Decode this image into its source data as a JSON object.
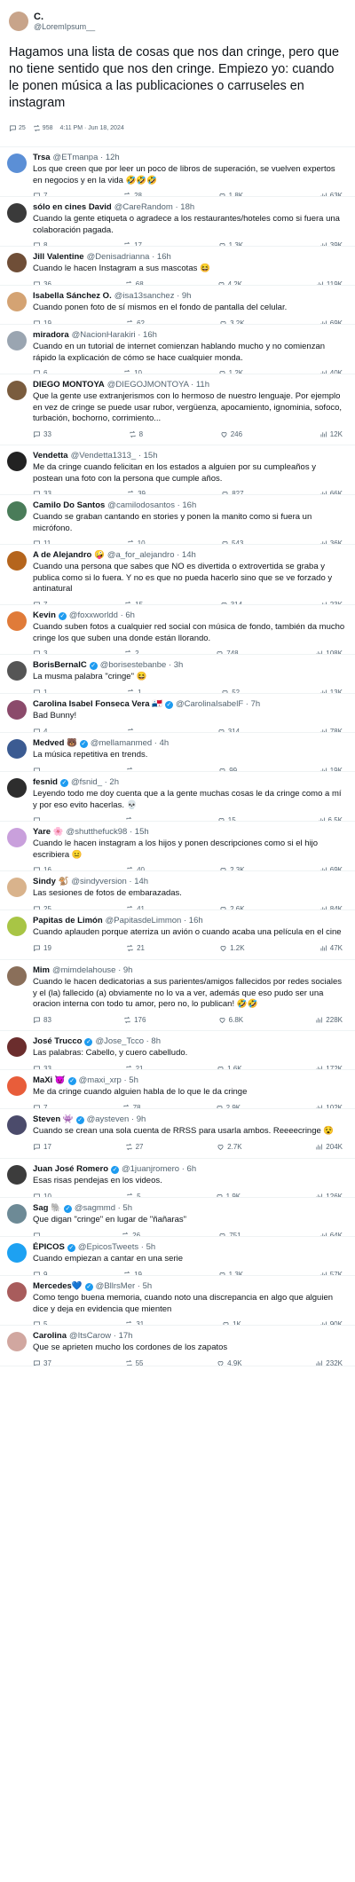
{
  "op": {
    "name": "C.",
    "handle": "@LoremIpsum__",
    "text": "Hagamos una lista de cosas que nos dan cringe, pero que no tiene sentido que nos den cringe. Empiezo yo: cuando le ponen música a las publicaciones o carruseles en instagram",
    "replies": "25",
    "reposts": "958",
    "timestamp": "4:11 PM · Jun 18, 2024",
    "avatar_color": "#c8a48a"
  },
  "replies": [
    {
      "name": "Trsa",
      "handle": "@ETmanpa · 12h",
      "verified": false,
      "text": "Los que creen que por leer un poco de libros de superación, se vuelven expertos en negocios y en la vida 🤣🤣🤣",
      "replies": "7",
      "reposts": "28",
      "likes": "1.8K",
      "views": "63K",
      "avatar": "#5b8fd6",
      "h": 56
    },
    {
      "name": "sólo en cines David",
      "handle": "@CareRandom · 18h",
      "verified": false,
      "text": "Cuando la gente etiqueta o agradece a los restaurantes/hoteles como si fuera una colaboración pagada.",
      "replies": "8",
      "reposts": "17",
      "likes": "1.3K",
      "views": "39K",
      "avatar": "#3a3a3a",
      "h": 56
    },
    {
      "name": "Jill Valentine",
      "handle": "@Denisadrianna · 16h",
      "verified": false,
      "text": "Cuando le hacen Instagram a sus mascotas 😆",
      "replies": "36",
      "reposts": "68",
      "likes": "4.2K",
      "views": "119K",
      "avatar": "#6f4e37",
      "h": 44
    },
    {
      "name": "Isabella Sánchez O.",
      "handle": "@isa13sanchez · 9h",
      "verified": false,
      "text": "Cuando ponen foto de sí mismos en el fondo de pantalla del celular.",
      "replies": "19",
      "reposts": "62",
      "likes": "3.2K",
      "views": "69K",
      "avatar": "#d4a373",
      "h": 44
    },
    {
      "name": "miradora",
      "handle": "@NacionHarakiri · 16h",
      "verified": false,
      "text": "Cuando en un tutorial de internet comienzan hablando mucho y no comienzan rápido la explicación de cómo se hace cualquier monda.",
      "replies": "6",
      "reposts": "10",
      "likes": "1.2K",
      "views": "40K",
      "avatar": "#9aa5b1",
      "h": 56
    },
    {
      "name": "DIEGO MONTOYA",
      "handle": "@DIEGOJMONTOYA · 11h",
      "verified": false,
      "text": "Que la gente use extranjerismos con lo hermoso de nuestro lenguaje. Por ejemplo en vez de cringe se puede usar rubor, vergüenza, apocamiento, ignominia, sofoco, turbación, bochorno, corrimiento...",
      "replies": "33",
      "reposts": "8",
      "likes": "246",
      "views": "12K",
      "avatar": "#7a5c3e",
      "h": 80
    },
    {
      "name": "Vendetta",
      "handle": "@Vendetta1313_ · 15h",
      "verified": false,
      "text": "Me da cringe cuando felicitan en los estados a alguien por su cumpleaños y postean una foto con la persona que cumple años.",
      "replies": "33",
      "reposts": "39",
      "likes": "827",
      "views": "66K",
      "avatar": "#222",
      "h": 56
    },
    {
      "name": "Camilo Do Santos",
      "handle": "@camilodosantos · 16h",
      "verified": false,
      "text": "Cuando se graban cantando en stories y ponen la manito como si fuera un micrófono.",
      "replies": "11",
      "reposts": "10",
      "likes": "543",
      "views": "36K",
      "avatar": "#4a7c59",
      "h": 56
    },
    {
      "name": "A de Alejandro 🤪",
      "handle": "@a_for_alejandro · 14h",
      "verified": false,
      "text": "Cuando una persona que sabes que NO es divertida o extrovertida se graba y publica como si lo fuera. Y no es que no pueda hacerlo sino que se ve forzado y antinatural",
      "replies": "7",
      "reposts": "15",
      "likes": "314",
      "views": "23K",
      "avatar": "#b5651d",
      "h": 68
    },
    {
      "name": "Kevin",
      "handle": "@foxxworldd · 6h",
      "verified": true,
      "text": "Cuando suben fotos a cualquier red social con música de fondo, también da mucho cringe los que suben una donde están llorando.",
      "replies": "3",
      "reposts": "2",
      "likes": "748",
      "views": "108K",
      "avatar": "#e07b39",
      "h": 56
    },
    {
      "name": "BorisBernalC",
      "handle": "@borisestebanbe · 3h",
      "verified": true,
      "text": "La musma palabra \"cringe\" 😆",
      "replies": "1",
      "reposts": "1",
      "likes": "52",
      "views": "13K",
      "avatar": "#555",
      "h": 44
    },
    {
      "name": "Carolina Isabel Fonseca Vera 🇵🇦",
      "handle": "@CarolinaIsabelF · 7h",
      "verified": true,
      "text": "Bad Bunny!",
      "replies": "4",
      "reposts": "",
      "likes": "314",
      "views": "78K",
      "avatar": "#8b4a6b",
      "h": 44
    },
    {
      "name": "Medved 🐻",
      "handle": "@mellamanmed · 4h",
      "verified": true,
      "text": "La música repetitiva en trends.",
      "replies": "",
      "reposts": "",
      "likes": "99",
      "views": "19K",
      "avatar": "#3b5b92",
      "h": 44
    },
    {
      "name": "fesnid",
      "handle": "@fsnid_ · 2h",
      "verified": true,
      "text": "Leyendo todo me doy cuenta que a la gente muchas cosas le da cringe como a mí y por eso evito hacerlas. 💀",
      "replies": "",
      "reposts": "",
      "likes": "15",
      "views": "6.5K",
      "avatar": "#2d2d2d",
      "h": 56
    },
    {
      "name": "Yare 🌸",
      "handle": "@shutthefuck98 · 15h",
      "verified": false,
      "text": "Cuando le hacen instagram a los hijos y ponen descripciones como si el hijo escribiera 😐",
      "replies": "16",
      "reposts": "40",
      "likes": "2.3K",
      "views": "69K",
      "avatar": "#c9a0dc",
      "h": 56
    },
    {
      "name": "Sindy 🐒",
      "handle": "@sindyversion · 14h",
      "verified": false,
      "text": "Las sesiones de fotos de embarazadas.",
      "replies": "25",
      "reposts": "41",
      "likes": "2.6K",
      "views": "84K",
      "avatar": "#d9b38c",
      "h": 44
    },
    {
      "name": "Papitas de Limón",
      "handle": "@PapitasdeLimmon · 16h",
      "verified": false,
      "text": "Cuando aplauden porque aterriza un avión o cuando acaba una película en el cine",
      "replies": "19",
      "reposts": "21",
      "likes": "1.2K",
      "views": "47K",
      "avatar": "#a8c545",
      "h": 56
    },
    {
      "name": "Mim",
      "handle": "@mimdelahouse · 9h",
      "verified": false,
      "text": "Cuando le hacen dedicatorias a sus parientes/amigos fallecidos por redes sociales y el (la) fallecido (a) obviamente no lo va a ver, además que eso pudo ser una oracion interna con todo tu amor, pero no, lo publican! 🤣🤣",
      "replies": "83",
      "reposts": "176",
      "likes": "6.8K",
      "views": "228K",
      "avatar": "#8a6f5a",
      "h": 80
    },
    {
      "name": "José Trucco",
      "handle": "@Jose_Tcco · 8h",
      "verified": true,
      "text": "Las palabras: Cabello, y cuero cabelludo.",
      "replies": "33",
      "reposts": "21",
      "likes": "1.6K",
      "views": "172K",
      "avatar": "#6b2d2d",
      "h": 44
    },
    {
      "name": "MaXi 😈",
      "handle": "@maxi_xrp · 5h",
      "verified": true,
      "text": "Me da cringe cuando alguien habla de lo que le da cringe",
      "replies": "7",
      "reposts": "78",
      "likes": "2.9K",
      "views": "102K",
      "avatar": "#e85d3a",
      "h": 44
    },
    {
      "name": "Steven 👾",
      "handle": "@aysteven · 9h",
      "verified": true,
      "text": "Cuando se crean una sola cuenta de RRSS para usarla ambos. Reeeecringe 😵",
      "replies": "17",
      "reposts": "27",
      "likes": "2.7K",
      "views": "204K",
      "avatar": "#4b4b6b",
      "h": 56
    },
    {
      "name": "Juan José Romero",
      "handle": "@1juanjromero · 6h",
      "verified": true,
      "text": "Esas risas pendejas en los videos.",
      "replies": "10",
      "reposts": "5",
      "likes": "1.9K",
      "views": "126K",
      "avatar": "#3c3c3c",
      "h": 44
    },
    {
      "name": "Sag 🐘",
      "handle": "@sagmmd · 5h",
      "verified": true,
      "text": "Que digan \"cringe\" en lugar de \"ñañaras\"",
      "replies": "",
      "reposts": "26",
      "likes": "751",
      "views": "64K",
      "avatar": "#6d8a96",
      "h": 44
    },
    {
      "name": "ÉPICOS",
      "handle": "@EpicosTweets · 5h",
      "verified": true,
      "text": "Cuando empiezan a cantar en una serie",
      "replies": "9",
      "reposts": "19",
      "likes": "1.3K",
      "views": "57K",
      "avatar": "#1da1f2",
      "h": 44
    },
    {
      "name": "Mercedes💙",
      "handle": "@BllrsMer · 5h",
      "verified": true,
      "text": "Como tengo buena memoria, cuando noto una discrepancia en algo que alguien dice y deja en evidencia que mienten",
      "replies": "5",
      "reposts": "31",
      "likes": "1K",
      "views": "90K",
      "avatar": "#a85c5c",
      "h": 56
    },
    {
      "name": "Carolina",
      "handle": "@ItsCarow · 17h",
      "verified": false,
      "text": "Que se aprieten mucho los cordones de los zapatos",
      "replies": "37",
      "reposts": "55",
      "likes": "4.9K",
      "views": "232K",
      "avatar": "#d1a7a0",
      "h": 46
    }
  ]
}
